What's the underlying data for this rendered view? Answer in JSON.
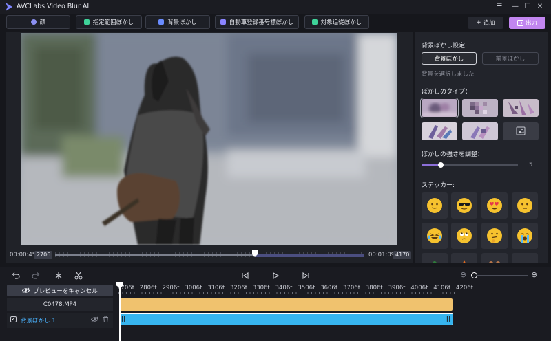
{
  "app": {
    "title": "AVCLabs Video Blur AI"
  },
  "window_controls": {
    "menu": "☰",
    "minimize": "—",
    "maximize": "☐",
    "close": "✕"
  },
  "toolbar": {
    "tools": [
      {
        "label": "顔",
        "icon": "face-icon",
        "color": "#8b8ff0"
      },
      {
        "label": "指定範囲ぼかし",
        "icon": "crosshair-icon",
        "color": "#3fd49a"
      },
      {
        "label": "背景ぼかし",
        "icon": "background-icon",
        "color": "#6a8cff"
      },
      {
        "label": "自動車登録番号標ぼかし",
        "icon": "car-icon",
        "color": "#8a84ff"
      },
      {
        "label": "対象追従ぼかし",
        "icon": "target-icon",
        "color": "#3fd49a"
      }
    ],
    "add_label": "追加",
    "add_icon": "+",
    "export_label": "出力"
  },
  "preview": {
    "current_time": "00:00:45",
    "current_frame": "2706",
    "end_time": "00:01:09",
    "end_frame": "4170"
  },
  "panel": {
    "blur_setting_title": "背景ぼかし設定:",
    "segments": [
      "背景ぼかし",
      "前景ぼかし"
    ],
    "selected_segment": "背景ぼかし",
    "hint": "背景を選択しました",
    "blur_type_title": "ぼかしのタイプ：",
    "blur_types": [
      "gaussian-blur",
      "mosaic",
      "pixel-blur",
      "glass-blur",
      "pixelate",
      "custom-image"
    ],
    "selected_blur_type": "gaussian-blur",
    "strength_title": "ぼかしの強さを調整：",
    "strength_value": "5",
    "strength_fraction": 0.2,
    "stickers_title": "ステッカー:",
    "stickers": [
      "slight-smile",
      "cool-sunglasses",
      "heart-eyes",
      "neutral-face",
      "laughing-tears",
      "rolling-eyes",
      "thinking-face",
      "crying-face",
      "partial-1",
      "partial-2",
      "partial-3",
      "partial-4"
    ]
  },
  "timeline": {
    "cancel_preview_label": "プレビューをキャンセル",
    "ruler_labels": [
      "2706f",
      "2806f",
      "2906f",
      "3006f",
      "3106f",
      "3206f",
      "3306f",
      "3406f",
      "3506f",
      "3606f",
      "3706f",
      "3806f",
      "3906f",
      "4006f",
      "4106f",
      "4206f"
    ],
    "file_name": "C0478.MP4",
    "layer_name": "背景ぼかし 1",
    "layer_checked": "✓",
    "zoom_out": "⊖",
    "zoom_in": "⊕",
    "clip_handle": "||"
  }
}
